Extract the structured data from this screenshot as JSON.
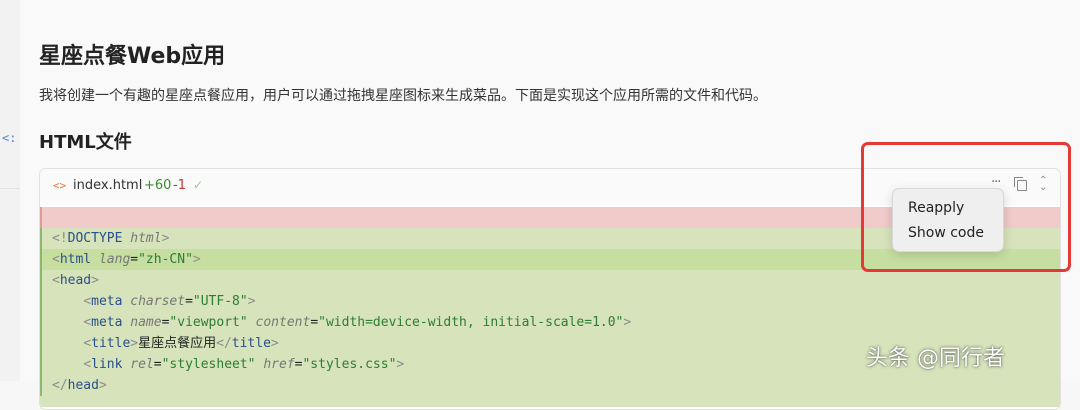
{
  "left_gutter": {
    "glyph": "<:"
  },
  "page": {
    "title": "星座点餐Web应用",
    "description": "我将创建一个有趣的星座点餐应用，用户可以通过拖拽星座图标来生成菜品。下面是实现这个应用所需的文件和代码。",
    "section_heading": "HTML文件"
  },
  "code_card": {
    "file_icon": "<>",
    "filename": "index.html",
    "added": "+60",
    "removed": "-1",
    "status_icon": "check-icon",
    "toolbar_icons": [
      "more-icon",
      "copy-icon",
      "expand-collapse-icon"
    ],
    "lines": [
      {
        "kind": "removed",
        "tokens": []
      },
      {
        "kind": "added",
        "tokens": [
          [
            "tag",
            "<!"
          ],
          [
            "tn",
            "DOCTYPE "
          ],
          [
            "at",
            "html"
          ],
          [
            "tag",
            ">"
          ]
        ]
      },
      {
        "kind": "added-highlight",
        "tokens": [
          [
            "tag",
            "<"
          ],
          [
            "tn",
            "html "
          ],
          [
            "at",
            "lang"
          ],
          [
            "cn",
            "="
          ],
          [
            "st",
            "\"zh-CN\""
          ],
          [
            "tag",
            ">"
          ]
        ]
      },
      {
        "kind": "added",
        "tokens": [
          [
            "tag",
            "<"
          ],
          [
            "tn",
            "head"
          ],
          [
            "tag",
            ">"
          ]
        ]
      },
      {
        "kind": "added",
        "tokens": [
          [
            "cn",
            "    "
          ],
          [
            "tag",
            "<"
          ],
          [
            "tn",
            "meta "
          ],
          [
            "at",
            "charset"
          ],
          [
            "cn",
            "="
          ],
          [
            "st",
            "\"UTF-8\""
          ],
          [
            "tag",
            ">"
          ]
        ]
      },
      {
        "kind": "added",
        "tokens": [
          [
            "cn",
            "    "
          ],
          [
            "tag",
            "<"
          ],
          [
            "tn",
            "meta "
          ],
          [
            "at",
            "name"
          ],
          [
            "cn",
            "="
          ],
          [
            "st",
            "\"viewport\" "
          ],
          [
            "at",
            "content"
          ],
          [
            "cn",
            "="
          ],
          [
            "st",
            "\"width=device-width, initial-scale=1.0\""
          ],
          [
            "tag",
            ">"
          ]
        ]
      },
      {
        "kind": "added",
        "tokens": [
          [
            "cn",
            "    "
          ],
          [
            "tag",
            "<"
          ],
          [
            "tn",
            "title"
          ],
          [
            "tag",
            ">"
          ],
          [
            "cn",
            "星座点餐应用"
          ],
          [
            "tag",
            "</"
          ],
          [
            "tn",
            "title"
          ],
          [
            "tag",
            ">"
          ]
        ]
      },
      {
        "kind": "added",
        "tokens": [
          [
            "cn",
            "    "
          ],
          [
            "tag",
            "<"
          ],
          [
            "tn",
            "link "
          ],
          [
            "at",
            "rel"
          ],
          [
            "cn",
            "="
          ],
          [
            "st",
            "\"stylesheet\" "
          ],
          [
            "at",
            "href"
          ],
          [
            "cn",
            "="
          ],
          [
            "st",
            "\"styles.css\""
          ],
          [
            "tag",
            ">"
          ]
        ]
      },
      {
        "kind": "added",
        "tokens": [
          [
            "tag",
            "</"
          ],
          [
            "tn",
            "head"
          ],
          [
            "tag",
            ">"
          ]
        ]
      }
    ]
  },
  "context_menu": {
    "items": [
      "Reapply",
      "Show code"
    ]
  },
  "watermark": "头条 @同行者",
  "colors": {
    "added_bg": "#d6e3bb",
    "removed_bg": "#f1caca",
    "highlight_bg": "#c6dfa0",
    "annotation_red": "#e53935"
  }
}
